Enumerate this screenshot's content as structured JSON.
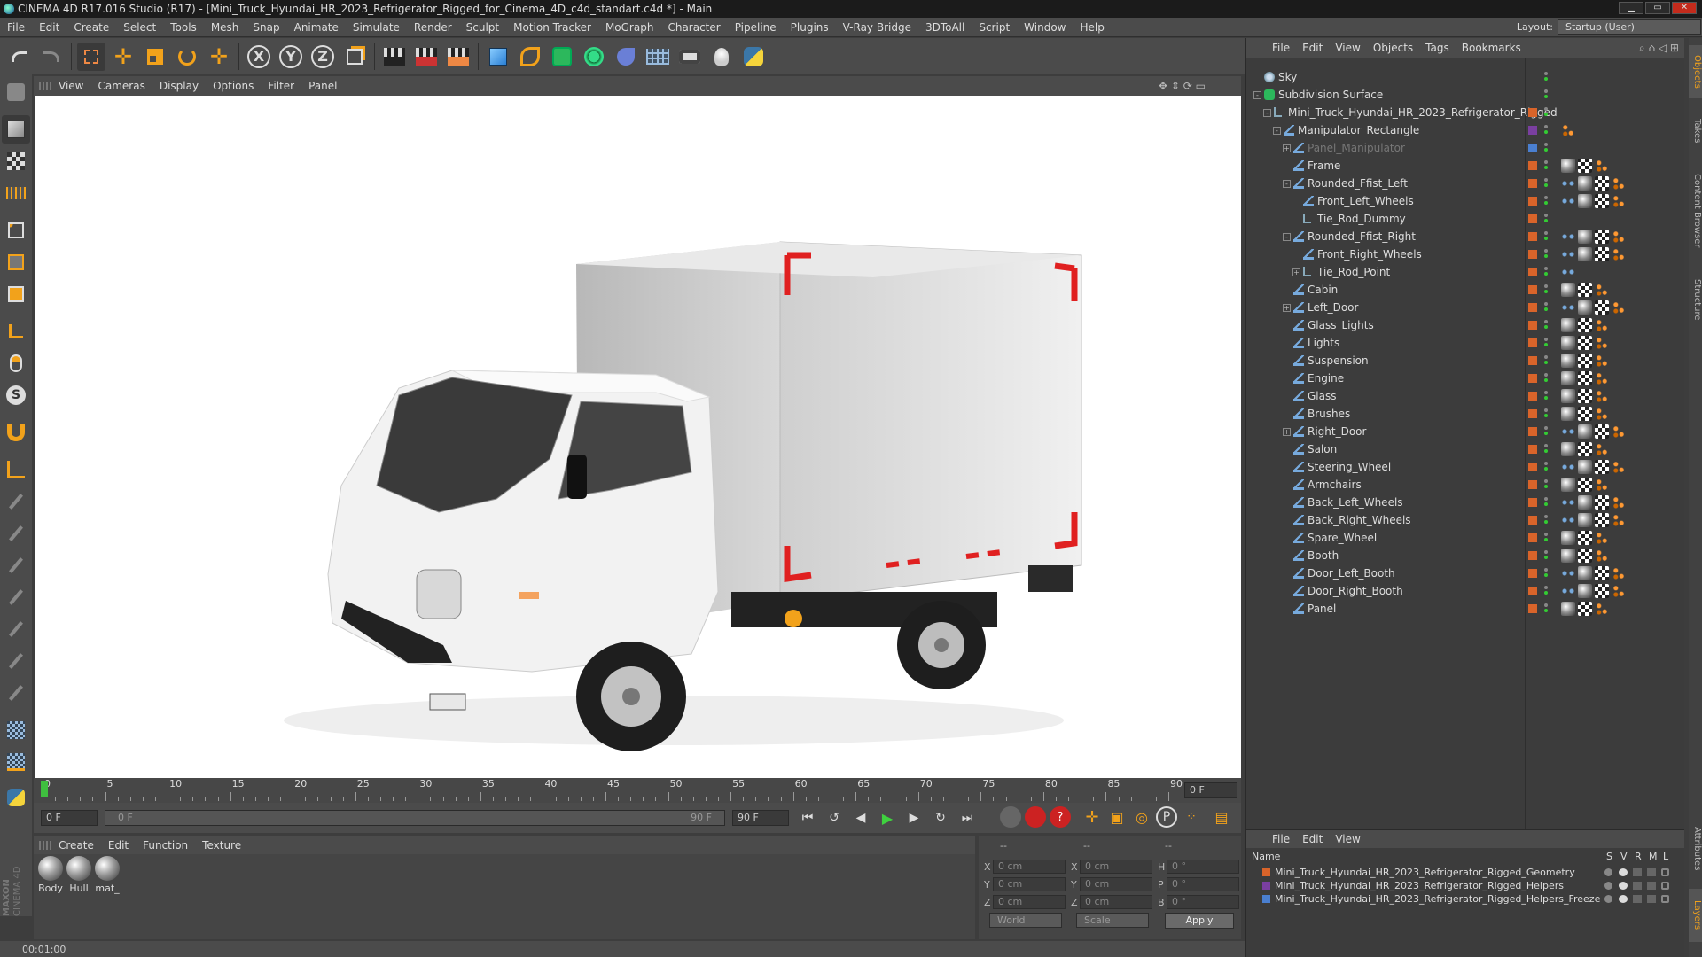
{
  "window": {
    "title": "CINEMA 4D R17.016 Studio (R17) - [Mini_Truck_Hyundai_HR_2023_Refrigerator_Rigged_for_Cinema_4D_c4d_standart.c4d *] - Main",
    "min": "▁",
    "max": "▭",
    "close": "✕"
  },
  "menu": [
    "File",
    "Edit",
    "Create",
    "Select",
    "Tools",
    "Mesh",
    "Snap",
    "Animate",
    "Simulate",
    "Render",
    "Sculpt",
    "Motion Tracker",
    "MoGraph",
    "Character",
    "Pipeline",
    "Plugins",
    "V-Ray Bridge",
    "3DToAll",
    "Script",
    "Window",
    "Help"
  ],
  "layout": {
    "label": "Layout:",
    "value": "Startup (User)"
  },
  "toolbar": {
    "x_axis": "X",
    "y_axis": "Y",
    "z_axis": "Z"
  },
  "viewport_menu": [
    "View",
    "Cameras",
    "Display",
    "Options",
    "Filter",
    "Panel"
  ],
  "timeline": {
    "ticks": [
      "0",
      "5",
      "10",
      "15",
      "20",
      "25",
      "30",
      "35",
      "40",
      "45",
      "50",
      "55",
      "60",
      "65",
      "70",
      "75",
      "80",
      "85",
      "90"
    ],
    "current_frame": "0 F"
  },
  "time_controls": {
    "start": "0 F",
    "range_start": "0 F",
    "range_end": "90 F",
    "end": "90 F"
  },
  "materials": {
    "menu": [
      "Create",
      "Edit",
      "Function",
      "Texture"
    ],
    "items": [
      "Body",
      "Hull",
      "mat_"
    ]
  },
  "coords": {
    "headers": [
      "--",
      "--",
      "--"
    ],
    "x_label": "X",
    "y_label": "Y",
    "z_label": "Z",
    "x2_label": "X",
    "y2_label": "Y",
    "z2_label": "Z",
    "h_label": "H",
    "p_label": "P",
    "b_label": "B",
    "x_pos": "0 cm",
    "y_pos": "0 cm",
    "z_pos": "0 cm",
    "x_size": "0 cm",
    "y_size": "0 cm",
    "z_size": "0 cm",
    "h_rot": "0 °",
    "p_rot": "0 °",
    "b_rot": "0 °",
    "space": "World",
    "mode": "Scale",
    "apply": "Apply"
  },
  "status": {
    "time": "00:01:00"
  },
  "object_manager": {
    "menu": [
      "File",
      "Edit",
      "View",
      "Objects",
      "Tags",
      "Bookmarks"
    ],
    "objects": [
      {
        "name": "Sky",
        "depth": 0,
        "icon": "sky-icon",
        "exp": "",
        "layer": "",
        "tags": ""
      },
      {
        "name": "Subdivision Surface",
        "depth": 0,
        "icon": "subdivision-icon",
        "exp": "-",
        "layer": "",
        "tags": ""
      },
      {
        "name": "Mini_Truck_Hyundai_HR_2023_Refrigerator_Rigged",
        "depth": 1,
        "icon": "null-icon",
        "exp": "-",
        "layer": "#d9642a",
        "tags": ""
      },
      {
        "name": "Manipulator_Rectangle",
        "depth": 2,
        "icon": "joint-icon",
        "exp": "-",
        "layer": "#7a3fa0",
        "tags": "p"
      },
      {
        "name": "Panel_Manipulator",
        "depth": 3,
        "icon": "joint-icon",
        "exp": "+",
        "layer": "#4a7fd0",
        "tags": "",
        "dim": true
      },
      {
        "name": "Frame",
        "depth": 3,
        "icon": "joint-icon",
        "exp": "",
        "layer": "#d9642a",
        "tags": "mcp"
      },
      {
        "name": "Rounded_Ffist_Left",
        "depth": 3,
        "icon": "joint-icon",
        "exp": "-",
        "layer": "#d9642a",
        "tags": "smcp"
      },
      {
        "name": "Front_Left_Wheels",
        "depth": 4,
        "icon": "joint-icon",
        "exp": "",
        "layer": "#d9642a",
        "tags": "smcp"
      },
      {
        "name": "Tie_Rod_Dummy",
        "depth": 4,
        "icon": "null-icon",
        "exp": "",
        "layer": "#d9642a",
        "tags": ""
      },
      {
        "name": "Rounded_Ffist_Right",
        "depth": 3,
        "icon": "joint-icon",
        "exp": "-",
        "layer": "#d9642a",
        "tags": "smcp"
      },
      {
        "name": "Front_Right_Wheels",
        "depth": 4,
        "icon": "joint-icon",
        "exp": "",
        "layer": "#d9642a",
        "tags": "smcp"
      },
      {
        "name": "Tie_Rod_Point",
        "depth": 4,
        "icon": "null-icon",
        "exp": "+",
        "layer": "#d9642a",
        "tags": "s"
      },
      {
        "name": "Cabin",
        "depth": 3,
        "icon": "joint-icon",
        "exp": "",
        "layer": "#d9642a",
        "tags": "mcp"
      },
      {
        "name": "Left_Door",
        "depth": 3,
        "icon": "joint-icon",
        "exp": "+",
        "layer": "#d9642a",
        "tags": "smcp"
      },
      {
        "name": "Glass_Lights",
        "depth": 3,
        "icon": "joint-icon",
        "exp": "",
        "layer": "#d9642a",
        "tags": "mcp"
      },
      {
        "name": "Lights",
        "depth": 3,
        "icon": "joint-icon",
        "exp": "",
        "layer": "#d9642a",
        "tags": "mcp"
      },
      {
        "name": "Suspension",
        "depth": 3,
        "icon": "joint-icon",
        "exp": "",
        "layer": "#d9642a",
        "tags": "mcp"
      },
      {
        "name": "Engine",
        "depth": 3,
        "icon": "joint-icon",
        "exp": "",
        "layer": "#d9642a",
        "tags": "mcp"
      },
      {
        "name": "Glass",
        "depth": 3,
        "icon": "joint-icon",
        "exp": "",
        "layer": "#d9642a",
        "tags": "mcp"
      },
      {
        "name": "Brushes",
        "depth": 3,
        "icon": "joint-icon",
        "exp": "",
        "layer": "#d9642a",
        "tags": "mcp"
      },
      {
        "name": "Right_Door",
        "depth": 3,
        "icon": "joint-icon",
        "exp": "+",
        "layer": "#d9642a",
        "tags": "smcp"
      },
      {
        "name": "Salon",
        "depth": 3,
        "icon": "joint-icon",
        "exp": "",
        "layer": "#d9642a",
        "tags": "mcp"
      },
      {
        "name": "Steering_Wheel",
        "depth": 3,
        "icon": "joint-icon",
        "exp": "",
        "layer": "#d9642a",
        "tags": "smcp"
      },
      {
        "name": "Armchairs",
        "depth": 3,
        "icon": "joint-icon",
        "exp": "",
        "layer": "#d9642a",
        "tags": "mcp"
      },
      {
        "name": "Back_Left_Wheels",
        "depth": 3,
        "icon": "joint-icon",
        "exp": "",
        "layer": "#d9642a",
        "tags": "smcp"
      },
      {
        "name": "Back_Right_Wheels",
        "depth": 3,
        "icon": "joint-icon",
        "exp": "",
        "layer": "#d9642a",
        "tags": "smcp"
      },
      {
        "name": "Spare_Wheel",
        "depth": 3,
        "icon": "joint-icon",
        "exp": "",
        "layer": "#d9642a",
        "tags": "mcp"
      },
      {
        "name": "Booth",
        "depth": 3,
        "icon": "joint-icon",
        "exp": "",
        "layer": "#d9642a",
        "tags": "mcp"
      },
      {
        "name": "Door_Left_Booth",
        "depth": 3,
        "icon": "joint-icon",
        "exp": "",
        "layer": "#d9642a",
        "tags": "smcp"
      },
      {
        "name": "Door_Right_Booth",
        "depth": 3,
        "icon": "joint-icon",
        "exp": "",
        "layer": "#d9642a",
        "tags": "smcp"
      },
      {
        "name": "Panel",
        "depth": 3,
        "icon": "joint-icon",
        "exp": "",
        "layer": "#d9642a",
        "tags": "mcp"
      }
    ]
  },
  "layer_manager": {
    "menu": [
      "File",
      "Edit",
      "View"
    ],
    "columns": {
      "name": "Name",
      "s": "S",
      "v": "V",
      "r": "R",
      "m": "M",
      "l": "L"
    },
    "layers": [
      {
        "name": "Mini_Truck_Hyundai_HR_2023_Refrigerator_Rigged_Geometry",
        "color": "#d9642a"
      },
      {
        "name": "Mini_Truck_Hyundai_HR_2023_Refrigerator_Rigged_Helpers",
        "color": "#7a3fa0"
      },
      {
        "name": "Mini_Truck_Hyundai_HR_2023_Refrigerator_Rigged_Helpers_Freeze",
        "color": "#4a7fd0"
      }
    ]
  },
  "right_tabs": [
    "Objects",
    "Takes",
    "Content Browser",
    "Structure",
    "Attributes",
    "Layers"
  ],
  "brand": {
    "line1": "MAXON",
    "line2": "CINEMA 4D"
  },
  "colors": {
    "accent_orange": "#d9642a",
    "timeline_marker": "#3fbf3f"
  }
}
